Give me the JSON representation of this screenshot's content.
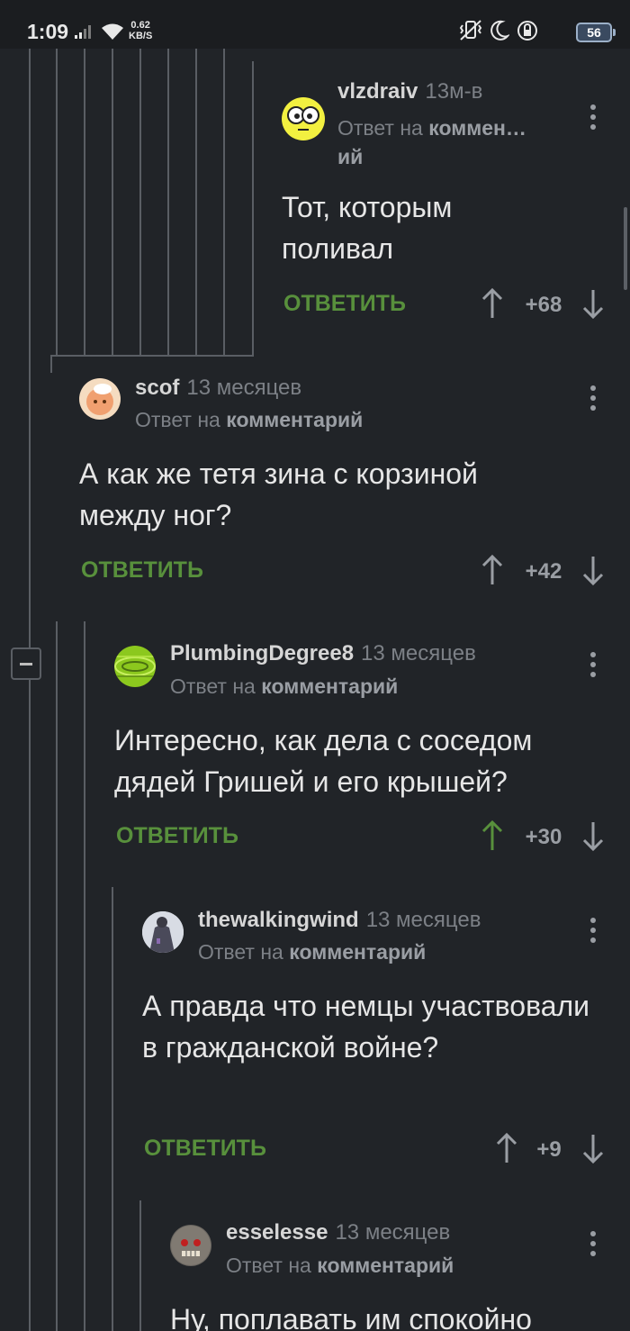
{
  "status_bar": {
    "time": "1:09",
    "net_speed_value": "0.62",
    "net_speed_unit": "KB/S",
    "battery": "56",
    "icons": [
      "signal-icon",
      "wifi-icon",
      "vibrate-icon",
      "moon-icon",
      "lock-rotation-icon",
      "battery-icon"
    ]
  },
  "colors": {
    "background": "#212428",
    "reply_green": "#58903c",
    "upvote_active": "#58903c",
    "thread_line": "#5a5e64"
  },
  "comments": [
    {
      "username": "vlzdraiv",
      "time": "13м-в",
      "reply_prefix": "Ответ на",
      "reply_target_line1": "коммен…",
      "reply_target_line2": "ий",
      "text": "Тот, которым поливал",
      "reply_label": "ОТВЕТИТЬ",
      "rating": "+68",
      "upvoted": false
    },
    {
      "username": "scof",
      "time": "13 месяцев",
      "reply_prefix": "Ответ на",
      "reply_target": "комментарий",
      "text": "А как же тетя зина с корзиной между ног?",
      "reply_label": "ОТВЕТИТЬ",
      "rating": "+42",
      "upvoted": false
    },
    {
      "username": "PlumbingDegree8",
      "time": "13 месяцев",
      "reply_prefix": "Ответ на",
      "reply_target": "комментарий",
      "text": "Интересно, как дела с соседом дядей Гришей и его крышей?",
      "reply_label": "ОТВЕТИТЬ",
      "rating": "+30",
      "upvoted": true
    },
    {
      "username": "thewalkingwind",
      "time": "13 месяцев",
      "reply_prefix": "Ответ на",
      "reply_target": "комментарий",
      "text": "А правда что немцы участвовали в гражданской войне?",
      "reply_label": "ОТВЕТИТЬ",
      "rating": "+9",
      "upvoted": false
    },
    {
      "username": "esselesse",
      "time": "13 месяцев",
      "reply_prefix": "Ответ на",
      "reply_target": "комментарий",
      "text": "Ну, поплавать им спокойно",
      "upvoted": false
    }
  ]
}
